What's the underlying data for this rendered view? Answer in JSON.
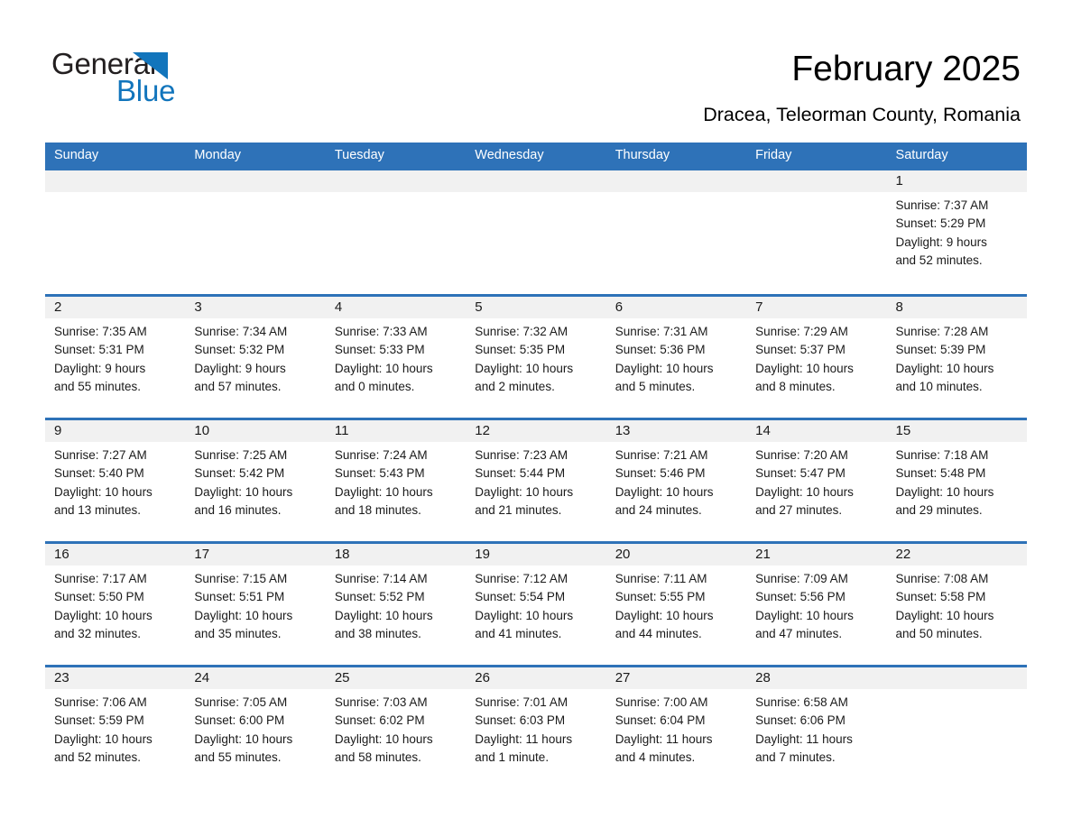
{
  "brand": {
    "name_part1": "General",
    "name_part2": "Blue",
    "accent_color": "#1275bc"
  },
  "header": {
    "title": "February 2025",
    "subtitle": "Dracea, Teleorman County, Romania"
  },
  "theme": {
    "header_blue": "#2e72b8",
    "row_divider_blue": "#2e72b8",
    "daynum_band_gray": "#f1f1f1",
    "text_color": "#1a1a1a"
  },
  "weekdays": [
    "Sunday",
    "Monday",
    "Tuesday",
    "Wednesday",
    "Thursday",
    "Friday",
    "Saturday"
  ],
  "weeks": [
    [
      {
        "empty": true
      },
      {
        "empty": true
      },
      {
        "empty": true
      },
      {
        "empty": true
      },
      {
        "empty": true
      },
      {
        "empty": true
      },
      {
        "day": "1",
        "sunrise": "Sunrise: 7:37 AM",
        "sunset": "Sunset: 5:29 PM",
        "daylight1": "Daylight: 9 hours",
        "daylight2": "and 52 minutes."
      }
    ],
    [
      {
        "day": "2",
        "sunrise": "Sunrise: 7:35 AM",
        "sunset": "Sunset: 5:31 PM",
        "daylight1": "Daylight: 9 hours",
        "daylight2": "and 55 minutes."
      },
      {
        "day": "3",
        "sunrise": "Sunrise: 7:34 AM",
        "sunset": "Sunset: 5:32 PM",
        "daylight1": "Daylight: 9 hours",
        "daylight2": "and 57 minutes."
      },
      {
        "day": "4",
        "sunrise": "Sunrise: 7:33 AM",
        "sunset": "Sunset: 5:33 PM",
        "daylight1": "Daylight: 10 hours",
        "daylight2": "and 0 minutes."
      },
      {
        "day": "5",
        "sunrise": "Sunrise: 7:32 AM",
        "sunset": "Sunset: 5:35 PM",
        "daylight1": "Daylight: 10 hours",
        "daylight2": "and 2 minutes."
      },
      {
        "day": "6",
        "sunrise": "Sunrise: 7:31 AM",
        "sunset": "Sunset: 5:36 PM",
        "daylight1": "Daylight: 10 hours",
        "daylight2": "and 5 minutes."
      },
      {
        "day": "7",
        "sunrise": "Sunrise: 7:29 AM",
        "sunset": "Sunset: 5:37 PM",
        "daylight1": "Daylight: 10 hours",
        "daylight2": "and 8 minutes."
      },
      {
        "day": "8",
        "sunrise": "Sunrise: 7:28 AM",
        "sunset": "Sunset: 5:39 PM",
        "daylight1": "Daylight: 10 hours",
        "daylight2": "and 10 minutes."
      }
    ],
    [
      {
        "day": "9",
        "sunrise": "Sunrise: 7:27 AM",
        "sunset": "Sunset: 5:40 PM",
        "daylight1": "Daylight: 10 hours",
        "daylight2": "and 13 minutes."
      },
      {
        "day": "10",
        "sunrise": "Sunrise: 7:25 AM",
        "sunset": "Sunset: 5:42 PM",
        "daylight1": "Daylight: 10 hours",
        "daylight2": "and 16 minutes."
      },
      {
        "day": "11",
        "sunrise": "Sunrise: 7:24 AM",
        "sunset": "Sunset: 5:43 PM",
        "daylight1": "Daylight: 10 hours",
        "daylight2": "and 18 minutes."
      },
      {
        "day": "12",
        "sunrise": "Sunrise: 7:23 AM",
        "sunset": "Sunset: 5:44 PM",
        "daylight1": "Daylight: 10 hours",
        "daylight2": "and 21 minutes."
      },
      {
        "day": "13",
        "sunrise": "Sunrise: 7:21 AM",
        "sunset": "Sunset: 5:46 PM",
        "daylight1": "Daylight: 10 hours",
        "daylight2": "and 24 minutes."
      },
      {
        "day": "14",
        "sunrise": "Sunrise: 7:20 AM",
        "sunset": "Sunset: 5:47 PM",
        "daylight1": "Daylight: 10 hours",
        "daylight2": "and 27 minutes."
      },
      {
        "day": "15",
        "sunrise": "Sunrise: 7:18 AM",
        "sunset": "Sunset: 5:48 PM",
        "daylight1": "Daylight: 10 hours",
        "daylight2": "and 29 minutes."
      }
    ],
    [
      {
        "day": "16",
        "sunrise": "Sunrise: 7:17 AM",
        "sunset": "Sunset: 5:50 PM",
        "daylight1": "Daylight: 10 hours",
        "daylight2": "and 32 minutes."
      },
      {
        "day": "17",
        "sunrise": "Sunrise: 7:15 AM",
        "sunset": "Sunset: 5:51 PM",
        "daylight1": "Daylight: 10 hours",
        "daylight2": "and 35 minutes."
      },
      {
        "day": "18",
        "sunrise": "Sunrise: 7:14 AM",
        "sunset": "Sunset: 5:52 PM",
        "daylight1": "Daylight: 10 hours",
        "daylight2": "and 38 minutes."
      },
      {
        "day": "19",
        "sunrise": "Sunrise: 7:12 AM",
        "sunset": "Sunset: 5:54 PM",
        "daylight1": "Daylight: 10 hours",
        "daylight2": "and 41 minutes."
      },
      {
        "day": "20",
        "sunrise": "Sunrise: 7:11 AM",
        "sunset": "Sunset: 5:55 PM",
        "daylight1": "Daylight: 10 hours",
        "daylight2": "and 44 minutes."
      },
      {
        "day": "21",
        "sunrise": "Sunrise: 7:09 AM",
        "sunset": "Sunset: 5:56 PM",
        "daylight1": "Daylight: 10 hours",
        "daylight2": "and 47 minutes."
      },
      {
        "day": "22",
        "sunrise": "Sunrise: 7:08 AM",
        "sunset": "Sunset: 5:58 PM",
        "daylight1": "Daylight: 10 hours",
        "daylight2": "and 50 minutes."
      }
    ],
    [
      {
        "day": "23",
        "sunrise": "Sunrise: 7:06 AM",
        "sunset": "Sunset: 5:59 PM",
        "daylight1": "Daylight: 10 hours",
        "daylight2": "and 52 minutes."
      },
      {
        "day": "24",
        "sunrise": "Sunrise: 7:05 AM",
        "sunset": "Sunset: 6:00 PM",
        "daylight1": "Daylight: 10 hours",
        "daylight2": "and 55 minutes."
      },
      {
        "day": "25",
        "sunrise": "Sunrise: 7:03 AM",
        "sunset": "Sunset: 6:02 PM",
        "daylight1": "Daylight: 10 hours",
        "daylight2": "and 58 minutes."
      },
      {
        "day": "26",
        "sunrise": "Sunrise: 7:01 AM",
        "sunset": "Sunset: 6:03 PM",
        "daylight1": "Daylight: 11 hours",
        "daylight2": "and 1 minute."
      },
      {
        "day": "27",
        "sunrise": "Sunrise: 7:00 AM",
        "sunset": "Sunset: 6:04 PM",
        "daylight1": "Daylight: 11 hours",
        "daylight2": "and 4 minutes."
      },
      {
        "day": "28",
        "sunrise": "Sunrise: 6:58 AM",
        "sunset": "Sunset: 6:06 PM",
        "daylight1": "Daylight: 11 hours",
        "daylight2": "and 7 minutes."
      },
      {
        "empty": true
      }
    ]
  ]
}
